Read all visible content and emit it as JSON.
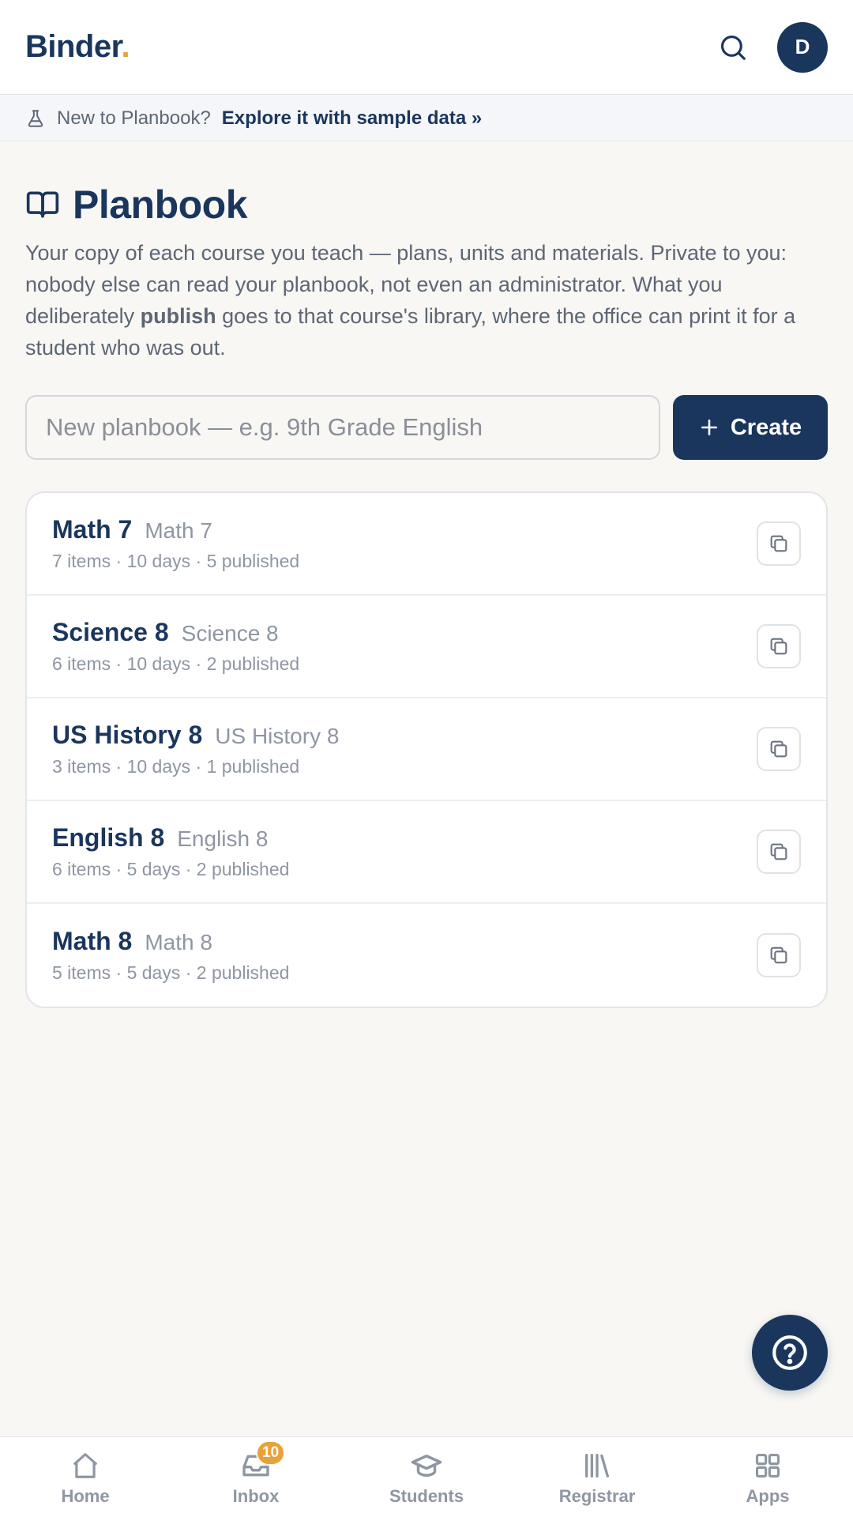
{
  "header": {
    "brand": "Binder",
    "brand_dot": ".",
    "avatar_initial": "D"
  },
  "banner": {
    "text": "New to Planbook?",
    "link": "Explore it with sample data »"
  },
  "page": {
    "title": "Planbook",
    "description_before": "Your copy of each course you teach — plans, units and materials. Private to you: nobody else can read your planbook, not even an administrator. What you deliberately ",
    "description_bold": "publish",
    "description_after": " goes to that course's library, where the office can print it for a student who was out."
  },
  "create": {
    "placeholder": "New planbook — e.g. 9th Grade English",
    "button_label": "Create"
  },
  "planbooks": [
    {
      "name": "Math 7",
      "course": "Math 7",
      "meta": "7 items · 10 days · 5 published"
    },
    {
      "name": "Science 8",
      "course": "Science 8",
      "meta": "6 items · 10 days · 2 published"
    },
    {
      "name": "US History 8",
      "course": "US History 8",
      "meta": "3 items · 10 days · 1 published"
    },
    {
      "name": "English 8",
      "course": "English 8",
      "meta": "6 items · 5 days · 2 published"
    },
    {
      "name": "Math 8",
      "course": "Math 8",
      "meta": "5 items · 5 days · 2 published"
    }
  ],
  "nav": {
    "items": [
      {
        "label": "Home",
        "icon": "home-icon"
      },
      {
        "label": "Inbox",
        "icon": "inbox-icon",
        "badge": "10"
      },
      {
        "label": "Students",
        "icon": "graduation-cap-icon"
      },
      {
        "label": "Registrar",
        "icon": "library-icon"
      },
      {
        "label": "Apps",
        "icon": "apps-grid-icon"
      }
    ]
  },
  "colors": {
    "primary": "#1b365d",
    "accent": "#e8a23a",
    "background": "#f8f7f4"
  }
}
